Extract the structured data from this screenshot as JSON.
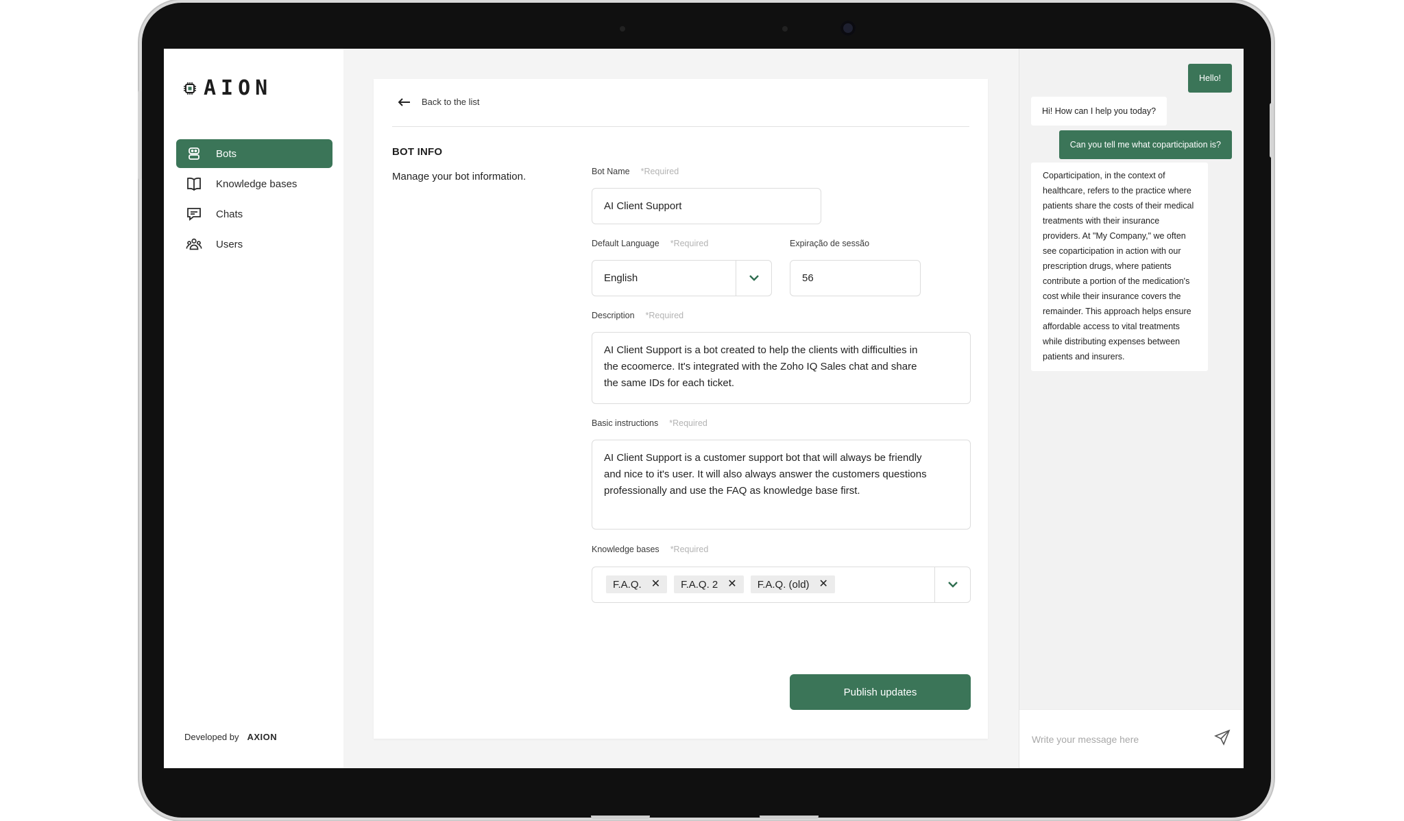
{
  "app": {
    "logo_text": "AION"
  },
  "sidebar": {
    "items": [
      {
        "label": "Bots",
        "icon": "bot-icon",
        "active": true
      },
      {
        "label": "Knowledge bases",
        "icon": "book-icon",
        "active": false
      },
      {
        "label": "Chats",
        "icon": "chat-bubble-icon",
        "active": false
      },
      {
        "label": "Users",
        "icon": "users-icon",
        "active": false
      }
    ],
    "developed_by": "Developed by",
    "developer": "AXION"
  },
  "main": {
    "back_label": "Back to the list",
    "section_title": "BOT INFO",
    "section_subtitle": "Manage your bot information.",
    "required_text": "*Required",
    "bot_name": {
      "label": "Bot Name",
      "value": "AI Client Support"
    },
    "default_language": {
      "label": "Default Language",
      "value": "English"
    },
    "session_expiration": {
      "label": "Expiração de sessão",
      "value": "56"
    },
    "description": {
      "label": "Description",
      "value": "AI Client Support is a bot created to help the clients with difficulties in the ecoomerce. It's integrated with the Zoho IQ Sales chat and share the same IDs for each ticket."
    },
    "basic_instructions": {
      "label": "Basic instructions",
      "value": "AI Client Support is a customer support bot that will always be friendly and nice to it's user. It will also always answer the customers questions professionally and use the FAQ as knowledge base first."
    },
    "knowledge_bases": {
      "label": "Knowledge bases",
      "tags": [
        "F.A.Q.",
        "F.A.Q. 2",
        "F.A.Q. (old)"
      ]
    },
    "publish_label": "Publish updates"
  },
  "chat": {
    "messages": [
      {
        "from": "user",
        "text": "Hello!"
      },
      {
        "from": "bot",
        "text": "Hi! How can I help you today?"
      },
      {
        "from": "user",
        "text": "Can you tell me what coparticipation is?"
      },
      {
        "from": "bot",
        "text": "Coparticipation, in the context of healthcare, refers to the practice where patients share the costs of their medical treatments with their insurance providers. At \"My Company,\" we often see coparticipation in action with our prescription drugs, where patients contribute a portion of the medication's cost while their insurance covers the remainder. This approach helps ensure affordable access to vital treatments while distributing expenses between patients and insurers."
      }
    ],
    "input_placeholder": "Write your message here"
  },
  "colors": {
    "accent": "#3b7558",
    "background": "#f4f4f4"
  }
}
